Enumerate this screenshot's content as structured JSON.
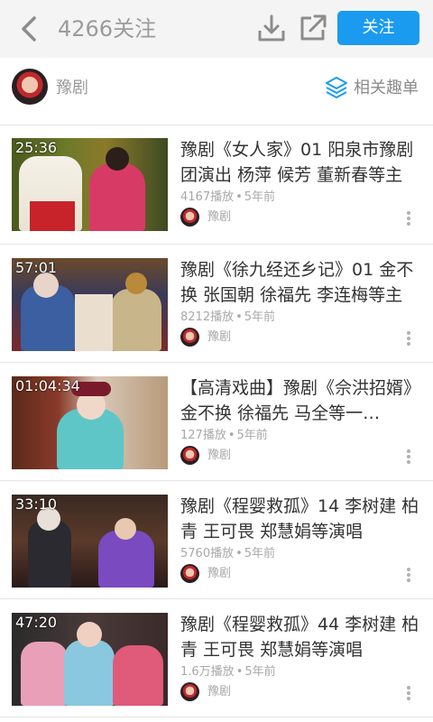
{
  "header": {
    "title": "4266关注",
    "follow_label": "关注",
    "back_icon": "chevron-left-icon",
    "download_icon": "download-icon",
    "share_icon": "external-share-icon"
  },
  "channel": {
    "name": "豫剧",
    "related_label": "相关趣单",
    "related_icon": "layers-icon"
  },
  "colors": {
    "accent": "#1a9bf0",
    "muted_text": "#a8a8a8"
  },
  "videos": [
    {
      "duration": "25:36",
      "title": "豫剧《女人家》01 阳泉市豫剧团演出 杨萍 候芳 董新春等主",
      "plays": "4167播放",
      "time": "5年前",
      "uploader": "豫剧"
    },
    {
      "duration": "57:01",
      "title": "豫剧《徐九经还乡记》01 金不换 张国朝 徐福先 李连梅等主",
      "plays": "8212播放",
      "time": "5年前",
      "uploader": "豫剧"
    },
    {
      "duration": "01:04:34",
      "title": "【高清戏曲】豫剧《佘洪招婿》金不换 徐福先 马全等一…",
      "plays": "127播放",
      "time": "5年前",
      "uploader": "豫剧"
    },
    {
      "duration": "33:10",
      "title": "豫剧《程婴救孤》14 李树建 柏青 王可畏 郑慧娟等演唱",
      "plays": "5760播放",
      "time": "5年前",
      "uploader": "豫剧"
    },
    {
      "duration": "47:20",
      "title": "豫剧《程婴救孤》44 李树建 柏青 王可畏 郑慧娟等演唱",
      "plays": "1.6万播放",
      "time": "5年前",
      "uploader": "豫剧"
    }
  ],
  "meta_separator": "•"
}
